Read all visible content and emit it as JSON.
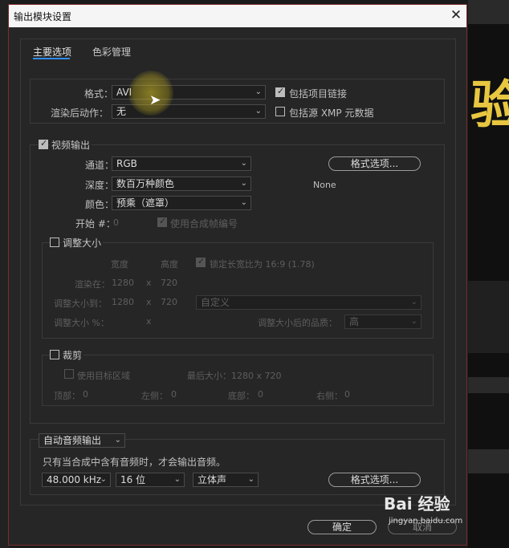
{
  "background": {
    "glyph": "验"
  },
  "dialog": {
    "title": "输出模块设置",
    "close_icon": "✕",
    "tabs": [
      {
        "label": "主要选项",
        "active": true
      },
      {
        "label": "色彩管理",
        "active": false
      }
    ],
    "main": {
      "format_label": "格式：",
      "format_value": "AVI",
      "post_render_label": "渲染后动作：",
      "post_render_value": "无",
      "include_project_link": {
        "label": "包括项目链接",
        "checked": true
      },
      "include_xmp": {
        "label": "包括源 XMP 元数据",
        "checked": false
      }
    },
    "video": {
      "checkbox_label": "视频输出",
      "checked": true,
      "channel_label": "通道：",
      "channel_value": "RGB",
      "depth_label": "深度：",
      "depth_value": "数百万种颜色",
      "color_label": "颜色：",
      "color_value": "预乘（遮罩）",
      "start_label": "开始 #：",
      "start_value": "0",
      "use_comp_frame": "使用合成帧编号",
      "format_options_button": "格式选项...",
      "codec_value": "None"
    },
    "resize": {
      "checkbox_label": "调整大小",
      "width_header": "宽度",
      "height_header": "高度",
      "lock_aspect": "锁定长宽比为 16:9 (1.78)",
      "rendering_at_label": "渲染在：",
      "rendering_w": "1280",
      "rendering_h": "720",
      "resize_to_label": "调整大小到：",
      "resize_w": "1280",
      "resize_h": "720",
      "preset_value": "自定义",
      "resize_pct_label": "调整大小 %：",
      "x_sign": "x",
      "quality_label": "调整大小后的品质：",
      "quality_value": "高"
    },
    "crop": {
      "checkbox_label": "裁剪",
      "use_roi": "使用目标区域",
      "final_size": "最后大小：1280 x 720",
      "top_label": "顶部：",
      "top_value": "0",
      "left_label": "左侧：",
      "left_value": "0",
      "bottom_label": "底部：",
      "bottom_value": "0",
      "right_label": "右侧：",
      "right_value": "0"
    },
    "audio": {
      "mode_value": "自动音频输出",
      "note": "只有当合成中含有音频时，才会输出音频。",
      "rate_value": "48.000 kHz",
      "bits_value": "16 位",
      "channels_value": "立体声",
      "format_options_button": "格式选项..."
    },
    "ok_button": "确定",
    "cancel_button": "取消"
  },
  "watermark": {
    "logo": "Bai 经验",
    "url": "jingyan.baidu.com"
  }
}
